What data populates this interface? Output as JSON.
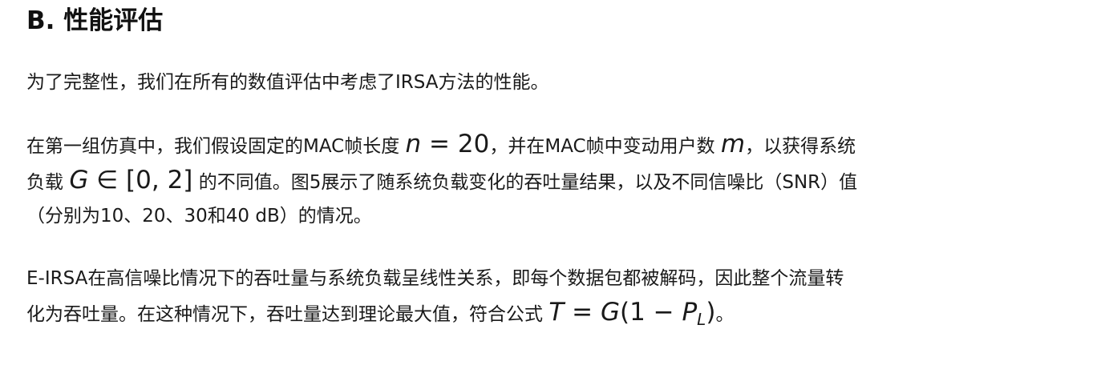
{
  "section": {
    "title": "B. 性能评估"
  },
  "paragraphs": {
    "p1": {
      "line1": "为了完整性，我们在所有的数值评估中考虑了IRSA方法的性能。"
    },
    "p2": {
      "l1_a": "在第一组仿真中，我们假设固定的MAC帧长度 ",
      "l1_var_n": "n",
      "l1_eq": " = 20",
      "l1_b": "，并在MAC帧中变动用户数 ",
      "l1_var_m": "m",
      "l1_c": "，以获得系统",
      "l2_a": "负载 ",
      "l2_var_G": "G",
      "l2_math": " ∈ [0, 2]",
      "l2_b": " 的不同值。图5展示了随系统负载变化的吞吐量结果，以及不同信噪比（SNR）值",
      "l3": "（分别为10、20、30和40 dB）的情况。"
    },
    "p3": {
      "l1": "E-IRSA在高信噪比情况下的吞吐量与系统负载呈线性关系，即每个数据包都被解码，因此整个流量转",
      "l2_a": "化为吞吐量。在这种情况下，吞吐量达到理论最大值，符合公式 ",
      "l2_var_T": "T",
      "l2_eq": " = ",
      "l2_var_G": "G",
      "l2_paren": "(1 − ",
      "l2_var_P": "P",
      "l2_sub_L": "L",
      "l2_close": ")",
      "l2_end": "。"
    }
  }
}
